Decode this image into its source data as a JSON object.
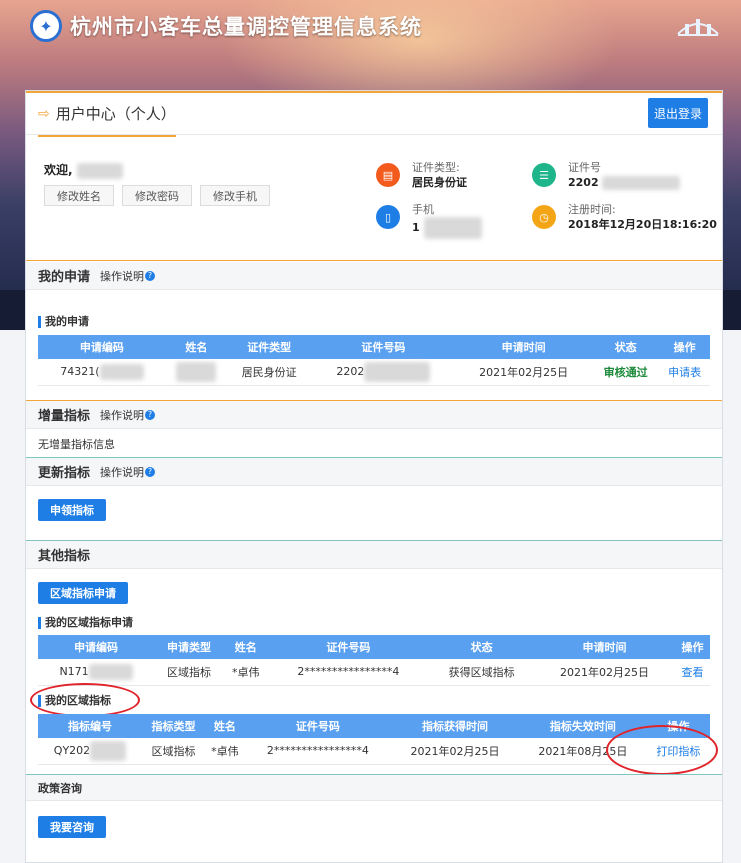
{
  "header": {
    "system_title": "杭州市小客车总量调控管理信息系统",
    "logo_icon": "hangzhou-emblem-icon",
    "city_logo_icon": "city-skyline-logo-icon"
  },
  "user_center": {
    "title": "用户中心（个人）",
    "logout_label": "退出登录"
  },
  "profile": {
    "welcome": "欢迎,",
    "buttons": [
      "修改姓名",
      "修改密码",
      "修改手机"
    ],
    "id_type_label": "证件类型:",
    "id_type_value": "居民身份证",
    "id_no_label": "证件号",
    "id_no_value": "2202",
    "phone_label": "手机",
    "phone_value": "1",
    "reg_time_label": "注册时间:",
    "reg_time_value": "2018年12月20日18:16:20"
  },
  "my_application": {
    "title": "我的申请",
    "help": "操作说明",
    "sub_title": "我的申请",
    "columns": [
      "申请编码",
      "姓名",
      "证件类型",
      "证件号码",
      "申请时间",
      "状态",
      "操作"
    ],
    "row": {
      "code": "74321(",
      "name": "",
      "id_type": "居民身份证",
      "id_no": "2202",
      "time": "2021年02月25日",
      "status": "审核通过",
      "action": "申请表"
    }
  },
  "increment": {
    "title": "增量指标",
    "help": "操作说明",
    "empty_text": "无增量指标信息"
  },
  "renewal": {
    "title": "更新指标",
    "help": "操作说明",
    "button": "申领指标"
  },
  "other": {
    "title": "其他指标",
    "apply_button": "区域指标申请",
    "sub_title_apply": "我的区域指标申请",
    "apply_columns": [
      "申请编码",
      "申请类型",
      "姓名",
      "证件号码",
      "状态",
      "申请时间",
      "操作"
    ],
    "apply_row": {
      "code": "N171",
      "type": "区域指标",
      "name": "*卓伟",
      "id_no": "2****************4",
      "status": "获得区域指标",
      "time": "2021年02月25日",
      "action": "查看"
    },
    "sub_title_quota": "我的区域指标",
    "quota_columns": [
      "指标编号",
      "指标类型",
      "姓名",
      "证件号码",
      "指标获得时间",
      "指标失效时间",
      "操作"
    ],
    "quota_row": {
      "code": "QY202",
      "type": "区域指标",
      "name": "*卓伟",
      "id_no": "2****************4",
      "get_time": "2021年02月25日",
      "expire_time": "2021年08月25日",
      "action": "打印指标"
    }
  },
  "policy": {
    "title": "政策咨询",
    "button": "我要咨询"
  },
  "colors": {
    "accent": "#1e7ee6",
    "orange": "#f4a53a",
    "success": "#1d8a3b",
    "annotation": "#e0242b"
  }
}
